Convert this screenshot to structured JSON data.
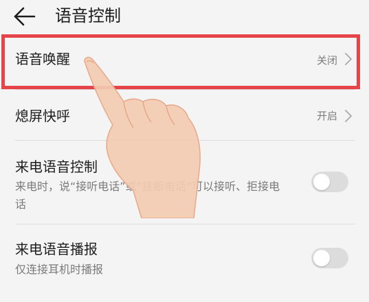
{
  "header": {
    "title": "语音控制"
  },
  "items": [
    {
      "title": "语音唤醒",
      "value": "关闭"
    },
    {
      "title": "熄屏快呼",
      "value": "开启"
    },
    {
      "title": "来电语音控制",
      "subtitle": "来电时，说“接听电话”或“挂断电话”可以接听、拒接电话",
      "toggle_on": false
    },
    {
      "title": "来电语音播报",
      "subtitle": "仅连接耳机时播报",
      "toggle_on": false
    }
  ],
  "colors": {
    "background": "#f4f4f4",
    "highlight": "#e5444a",
    "toggle_off": "#dcdcdc"
  },
  "icons": [
    "back-arrow-icon",
    "chevron-right-icon",
    "pointing-hand-icon"
  ]
}
